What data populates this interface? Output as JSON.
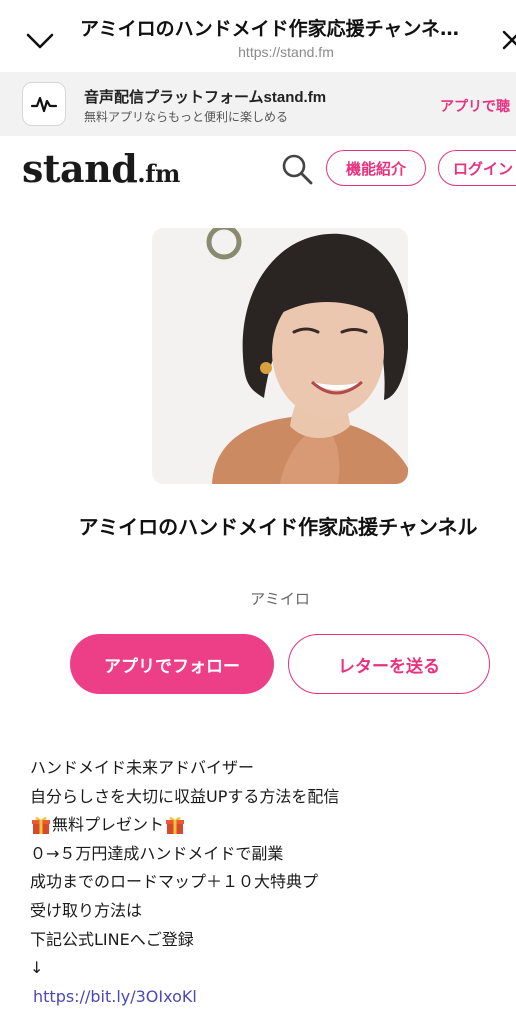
{
  "browser": {
    "title": "アミイロのハンドメイド作家応援チャンネ…",
    "url": "https://stand.fm"
  },
  "app_banner": {
    "title": "音声配信プラットフォームstand.fm",
    "subtitle": "無料アプリならもっと便利に楽しめる",
    "cta": "アプリで聴"
  },
  "header": {
    "logo_main": "stand",
    "logo_suffix": ".fm",
    "features_label": "機能紹介",
    "login_label": "ログイン"
  },
  "channel": {
    "title": "アミイロのハンドメイド作家応援チャンネル",
    "owner": "アミイロ",
    "follow_label": "アプリでフォロー",
    "letter_label": "レターを送る"
  },
  "description": {
    "line1": "ハンドメイド未来アドバイザー",
    "line2": "自分らしさを大切に収益UPする方法を配信",
    "line3": "無料プレゼント",
    "line4": "０→５万円達成ハンドメイドで副業",
    "line5": "成功までのロードマップ＋１０大特典プ",
    "line6": "受け取り方法は",
    "line7": "下記公式LINEへご登録",
    "line8": "↓",
    "link": "https://bit.ly/3OIxoKl"
  },
  "colors": {
    "accent": "#e8327f",
    "banner_bg": "#f2f2f2",
    "link": "#4b48b8"
  },
  "icons": {
    "back": "chevron-down-icon",
    "close": "close-icon",
    "app": "waveform-icon",
    "search": "search-icon",
    "gift": "gift-icon"
  }
}
